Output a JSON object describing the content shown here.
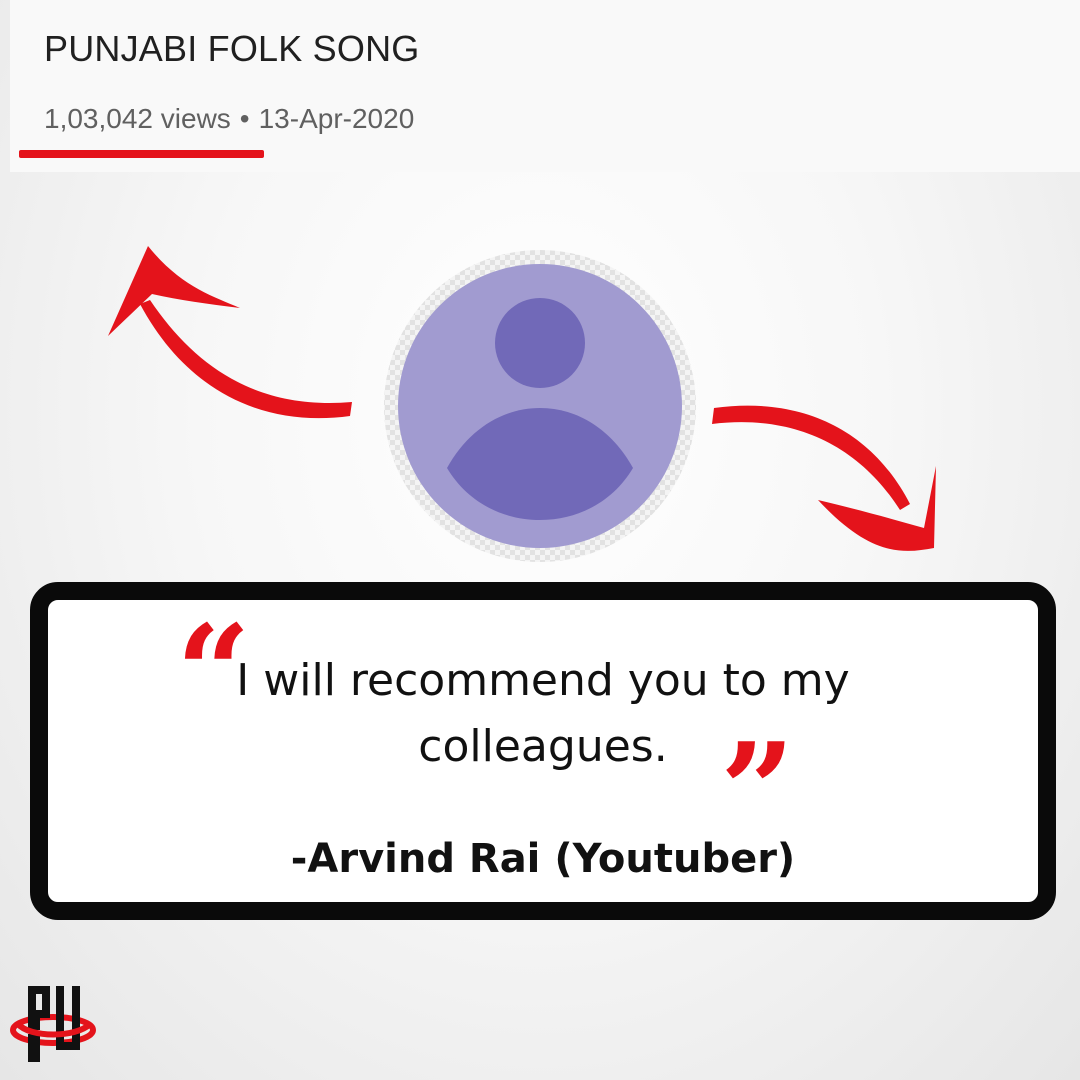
{
  "video": {
    "title": "PUNJABI FOLK SONG",
    "views": "1,03,042 views",
    "separator": "•",
    "date": "13-Apr-2020"
  },
  "avatar": {
    "icon": "user-avatar-icon"
  },
  "testimonial": {
    "open_quote": "“",
    "close_quote": "”",
    "line1": "I will recommend you to my",
    "line2": "colleagues.",
    "author": "-Arvind Rai (Youtuber)"
  },
  "colors": {
    "accent_red": "#e4131b",
    "avatar_light": "#a19bd0",
    "avatar_dark": "#7169b8",
    "box_border": "#0a0a0a"
  },
  "logo": {
    "icon": "brand-logo-icon",
    "letters": "PU"
  }
}
